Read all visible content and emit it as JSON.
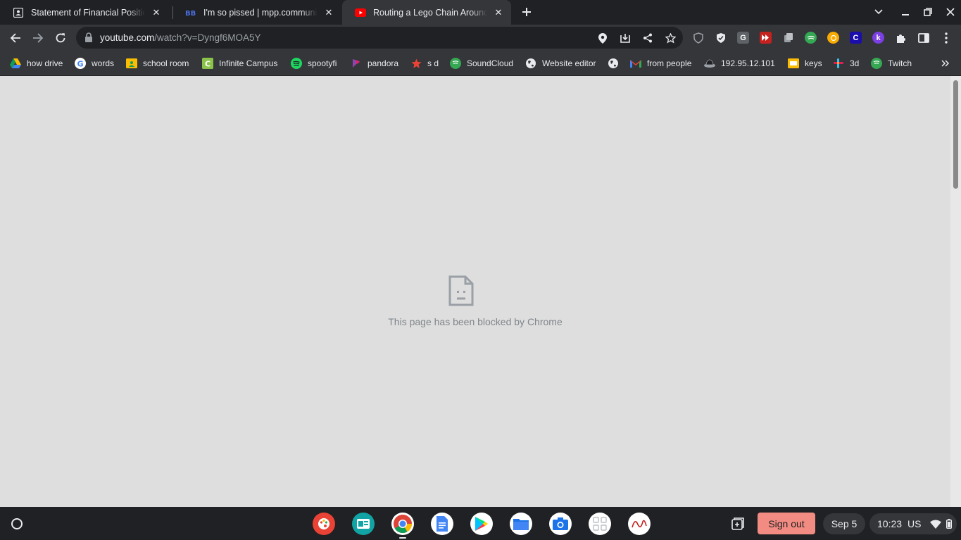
{
  "tabs": [
    {
      "title": "Statement of Financial Position",
      "favicon": "classroom-icon",
      "active": false
    },
    {
      "title": "I'm so pissed | mpp.community",
      "favicon": "mpp-icon",
      "active": false
    },
    {
      "title": "Routing a Lego Chain Around Mo",
      "favicon": "youtube-icon",
      "active": true
    }
  ],
  "omnibox": {
    "domain": "youtube.com",
    "path": "/watch?v=Dyngf6MOA5Y"
  },
  "bookmarks": [
    {
      "label": "how drive",
      "icon": "drive-icon"
    },
    {
      "label": "words",
      "icon": "google-icon"
    },
    {
      "label": "school room",
      "icon": "classroom-icon"
    },
    {
      "label": "Infinite Campus",
      "icon": "campus-icon"
    },
    {
      "label": "spootyfi",
      "icon": "spotify-icon"
    },
    {
      "label": "pandora",
      "icon": "pandora-icon"
    },
    {
      "label": "s d",
      "icon": "star-icon"
    },
    {
      "label": "SoundCloud",
      "icon": "soundcloud-icon"
    },
    {
      "label": "Website editor",
      "icon": "globe-icon"
    },
    {
      "label": "",
      "icon": "globe-icon"
    },
    {
      "label": "from people",
      "icon": "gmail-icon"
    },
    {
      "label": "192.95.12.101",
      "icon": "hat-icon"
    },
    {
      "label": "keys",
      "icon": "slides-icon"
    },
    {
      "label": "3d",
      "icon": "slack-icon"
    },
    {
      "label": "Twitch",
      "icon": "twitch-icon"
    }
  ],
  "content": {
    "message": "This page has been blocked by Chrome"
  },
  "shelf": {
    "sign_out": "Sign out",
    "date": "Sep 5",
    "time": "10:23",
    "locale": "US"
  },
  "colors": {
    "browser_frame": "#202124",
    "toolbar": "#35363a",
    "content_bg": "#dedede",
    "sign_out": "#f28b82"
  }
}
